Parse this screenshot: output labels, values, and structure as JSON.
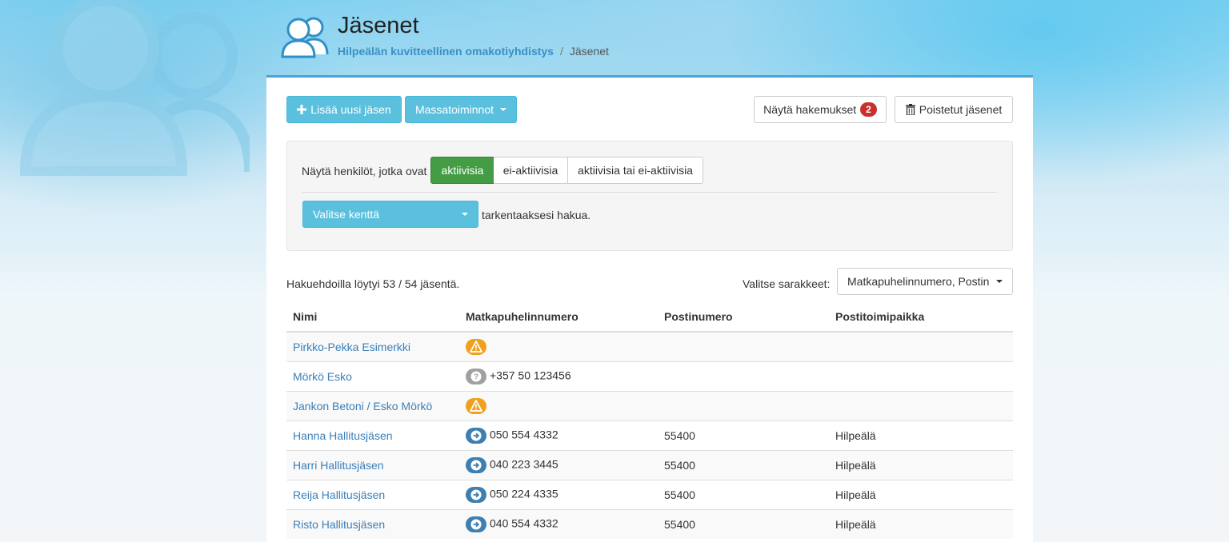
{
  "header": {
    "title": "Jäsenet",
    "breadcrumb_org": "Hilpeälän kuvitteellinen omakotiyhdistys",
    "breadcrumb_current": "Jäsenet"
  },
  "toolbar": {
    "add_member": "Lisää uusi jäsen",
    "bulk_actions": "Massatoiminnot",
    "show_applications": "Näytä hakemukset",
    "applications_count": "2",
    "deleted_members": "Poistetut jäsenet"
  },
  "filter": {
    "label": "Näytä henkilöt, jotka ovat",
    "options": [
      "aktiivisia",
      "ei-aktiivisia",
      "aktiivisia tai ei-aktiivisia"
    ],
    "selected": "aktiivisia",
    "field_select": "Valitse kenttä",
    "field_suffix": "tarkentaaksesi hakua."
  },
  "results": {
    "summary": "Hakuehdoilla löytyi 53 / 54 jäsentä.",
    "columns_label": "Valitse sarakkeet:",
    "columns_value": "Matkapuhelinnumero, Postinumero, Postitoimipaikka"
  },
  "table": {
    "headers": [
      "Nimi",
      "Matkapuhelinnumero",
      "Postinumero",
      "Postitoimipaikka"
    ],
    "rows": [
      {
        "name": "Pirkko-Pekka Esimerkki",
        "status": "warning-icon",
        "phone": "",
        "zip": "",
        "city": ""
      },
      {
        "name": "Mörkö Esko",
        "status": "question-icon",
        "phone": "+357 50 123456",
        "zip": "",
        "city": ""
      },
      {
        "name": "Jankon Betoni / Esko Mörkö",
        "status": "warning-icon",
        "phone": "",
        "zip": "",
        "city": ""
      },
      {
        "name": "Hanna Hallitusjäsen",
        "status": "arrow-right-icon",
        "phone": "050 554 4332",
        "zip": "55400",
        "city": "Hilpeälä"
      },
      {
        "name": "Harri Hallitusjäsen",
        "status": "arrow-right-icon",
        "phone": "040 223 3445",
        "zip": "55400",
        "city": "Hilpeälä"
      },
      {
        "name": "Reija Hallitusjäsen",
        "status": "arrow-right-icon",
        "phone": "050 224 4335",
        "zip": "55400",
        "city": "Hilpeälä"
      },
      {
        "name": "Risto Hallitusjäsen",
        "status": "arrow-right-icon",
        "phone": "040 554 4332",
        "zip": "55400",
        "city": "Hilpeälä"
      }
    ]
  },
  "colors": {
    "info": "#5bc0de",
    "success": "#449d44",
    "link": "#3a7fb8",
    "warning": "#f0a01e",
    "muted": "#a0a0a0",
    "primary_icon": "#3d7fb0",
    "badge": "#c9302c"
  }
}
